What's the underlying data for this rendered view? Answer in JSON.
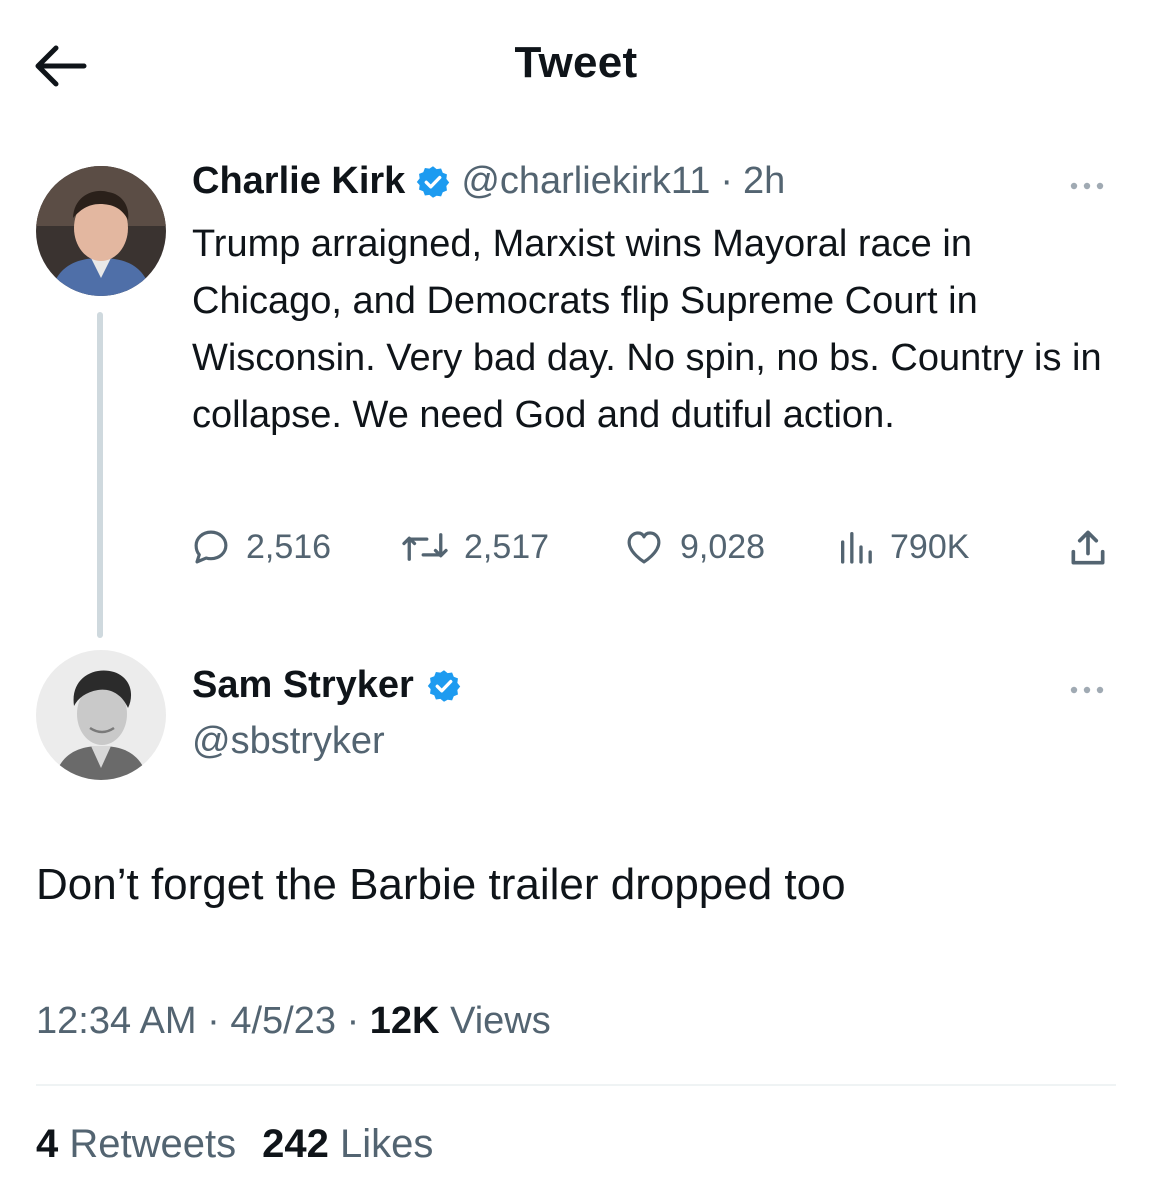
{
  "header": {
    "title": "Tweet",
    "back_icon": "arrow-left-icon"
  },
  "quoted_tweet": {
    "author_name": "Charlie Kirk",
    "verified": true,
    "handle": "@charliekirk11",
    "separator": "·",
    "time": "2h",
    "text": "Trump arraigned, Marxist wins Mayoral race in Chicago, and Democrats flip Supreme Court in Wisconsin. Very bad day. No spin, no bs. Country is in collapse. We need God and dutiful action.",
    "actions": {
      "replies": "2,516",
      "retweets": "2,517",
      "likes": "9,028",
      "views": "790K"
    }
  },
  "reply_tweet": {
    "author_name": "Sam Stryker",
    "verified": true,
    "handle": "@sbstryker",
    "text": "Don’t forget the Barbie trailer dropped too",
    "time": "12:34 AM",
    "sep1": "·",
    "date": "4/5/23",
    "sep2": "·",
    "views_count": "12K",
    "views_label": "Views",
    "retweets_count": "4",
    "retweets_label": "Retweets",
    "likes_count": "242",
    "likes_label": "Likes"
  },
  "colors": {
    "text": "#0f1419",
    "secondary": "#536471",
    "verified": "#1d9bf0",
    "divider": "#eff3f4"
  }
}
